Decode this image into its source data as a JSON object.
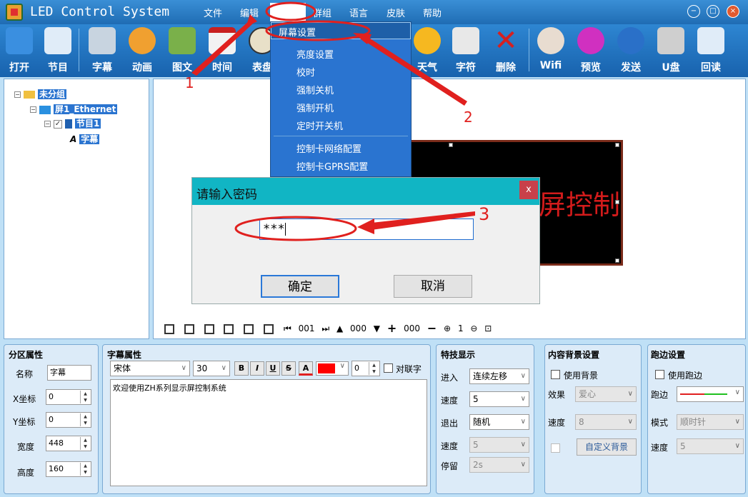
{
  "app": {
    "title": "LED Control System"
  },
  "menu": [
    "文件",
    "编辑",
    "设置",
    "群组",
    "语言",
    "皮肤",
    "帮助"
  ],
  "toolbar": [
    {
      "label": "打开",
      "icon": "folder-icon",
      "color": "#3a8fe0"
    },
    {
      "label": "节目",
      "icon": "program-icon",
      "color": "#e0ecf8"
    },
    {
      "label": "字幕",
      "icon": "text-icon",
      "color": "#c8d4e0"
    },
    {
      "label": "动画",
      "icon": "animation-icon",
      "color": "#f0a030"
    },
    {
      "label": "图文",
      "icon": "picture-icon",
      "color": "#7ab04a"
    },
    {
      "label": "时间",
      "icon": "calendar-icon",
      "color": "#f2f2f2"
    },
    {
      "label": "表盘",
      "icon": "clock-icon",
      "color": "#e8e0c8"
    },
    {
      "label": "天气",
      "icon": "sun-icon",
      "color": "#f6b820"
    },
    {
      "label": "字符",
      "icon": "char-icon",
      "color": "#e8e8e8"
    },
    {
      "label": "删除",
      "icon": "delete-icon",
      "color": "#d62020"
    },
    {
      "label": "Wifi",
      "icon": "wifi-icon",
      "color": "#e8dcd0"
    },
    {
      "label": "预览",
      "icon": "preview-icon",
      "color": "#d030c0"
    },
    {
      "label": "发送",
      "icon": "send-icon",
      "color": "#2a70c8"
    },
    {
      "label": "U盘",
      "icon": "usb-icon",
      "color": "#cfcfcf"
    },
    {
      "label": "回读",
      "icon": "readback-icon",
      "color": "#e0ecf8"
    }
  ],
  "dropdown": {
    "selected": "屏幕设置",
    "items": [
      "亮度设置",
      "校时",
      "强制关机",
      "强制开机",
      "定时开关机"
    ],
    "items2": [
      "控制卡网络配置",
      "控制卡GPRS配置"
    ]
  },
  "tree": {
    "group": "未分组",
    "screen": "屏1_Ethernet",
    "program": "节目1",
    "item": "字幕"
  },
  "led_text": "示屏控制",
  "canvas_toolbar": {
    "page": "001",
    "layer": "000",
    "zoom": "000",
    "count": "1"
  },
  "modal": {
    "title": "请输入密码",
    "close": "x",
    "password": "***",
    "ok": "确定",
    "cancel": "取消"
  },
  "zone": {
    "title": "分区属性",
    "name_label": "名称",
    "name_value": "字幕",
    "x_label": "X坐标",
    "x_value": "0",
    "y_label": "Y坐标",
    "y_value": "0",
    "w_label": "宽度",
    "w_value": "448",
    "h_label": "高度",
    "h_value": "160"
  },
  "subtitle": {
    "title": "字幕属性",
    "font": "宋体",
    "size": "30",
    "b": "B",
    "i": "I",
    "u": "U",
    "s": "S",
    "a": "A",
    "text_color": "#ff0000",
    "spacing": "0",
    "link_label": "对联字",
    "content": "欢迎使用ZH系列显示屏控制系统"
  },
  "effects": {
    "title": "特技显示",
    "enter_label": "进入",
    "enter_value": "连续左移",
    "speed_label": "速度",
    "speed_value": "5",
    "exit_label": "退出",
    "exit_value": "随机",
    "speed2_label": "速度",
    "speed2_value": "5",
    "stay_label": "停留",
    "stay_value": "2s"
  },
  "background": {
    "title": "内容背景设置",
    "use_label": "使用背景",
    "effect_label": "效果",
    "effect_value": "爱心",
    "speed_label": "速度",
    "speed_value": "8",
    "custom_button": "自定义背景"
  },
  "border": {
    "title": "跑边设置",
    "use_label": "使用跑边",
    "border_label": "跑边",
    "mode_label": "模式",
    "mode_value": "顺时针",
    "speed_label": "速度",
    "speed_value": "5"
  },
  "annotations": [
    "1",
    "2",
    "3"
  ]
}
